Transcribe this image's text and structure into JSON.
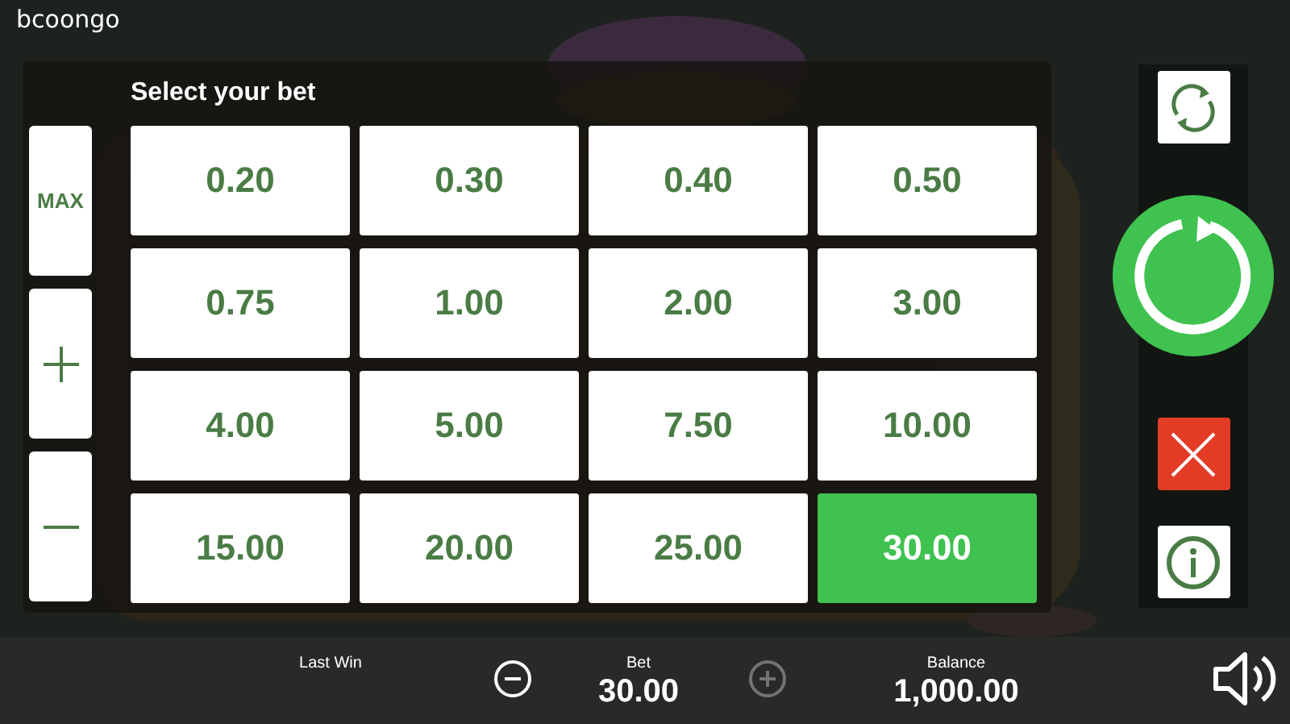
{
  "brand": "bcoongo",
  "bet_panel": {
    "title": "Select your bet",
    "side_buttons": [
      {
        "kind": "max",
        "label": "MAX"
      },
      {
        "kind": "plus"
      },
      {
        "kind": "minus"
      }
    ],
    "bets": [
      {
        "label": "0.20",
        "selected": false
      },
      {
        "label": "0.30",
        "selected": false
      },
      {
        "label": "0.40",
        "selected": false
      },
      {
        "label": "0.50",
        "selected": false
      },
      {
        "label": "0.75",
        "selected": false
      },
      {
        "label": "1.00",
        "selected": false
      },
      {
        "label": "2.00",
        "selected": false
      },
      {
        "label": "3.00",
        "selected": false
      },
      {
        "label": "4.00",
        "selected": false
      },
      {
        "label": "5.00",
        "selected": false
      },
      {
        "label": "7.50",
        "selected": false
      },
      {
        "label": "10.00",
        "selected": false
      },
      {
        "label": "15.00",
        "selected": false
      },
      {
        "label": "20.00",
        "selected": false
      },
      {
        "label": "25.00",
        "selected": false
      },
      {
        "label": "30.00",
        "selected": true
      }
    ]
  },
  "right_controls": [
    {
      "kind": "autoplay"
    },
    {
      "kind": "spin"
    },
    {
      "kind": "close"
    },
    {
      "kind": "info"
    }
  ],
  "bottom_bar": {
    "last_win": {
      "label": "Last Win"
    },
    "bet_minus": {
      "disabled": false
    },
    "bet": {
      "label": "Bet",
      "value": "30.00"
    },
    "bet_plus": {
      "disabled": true
    },
    "balance": {
      "label": "Balance",
      "value": "1,000.00"
    }
  }
}
